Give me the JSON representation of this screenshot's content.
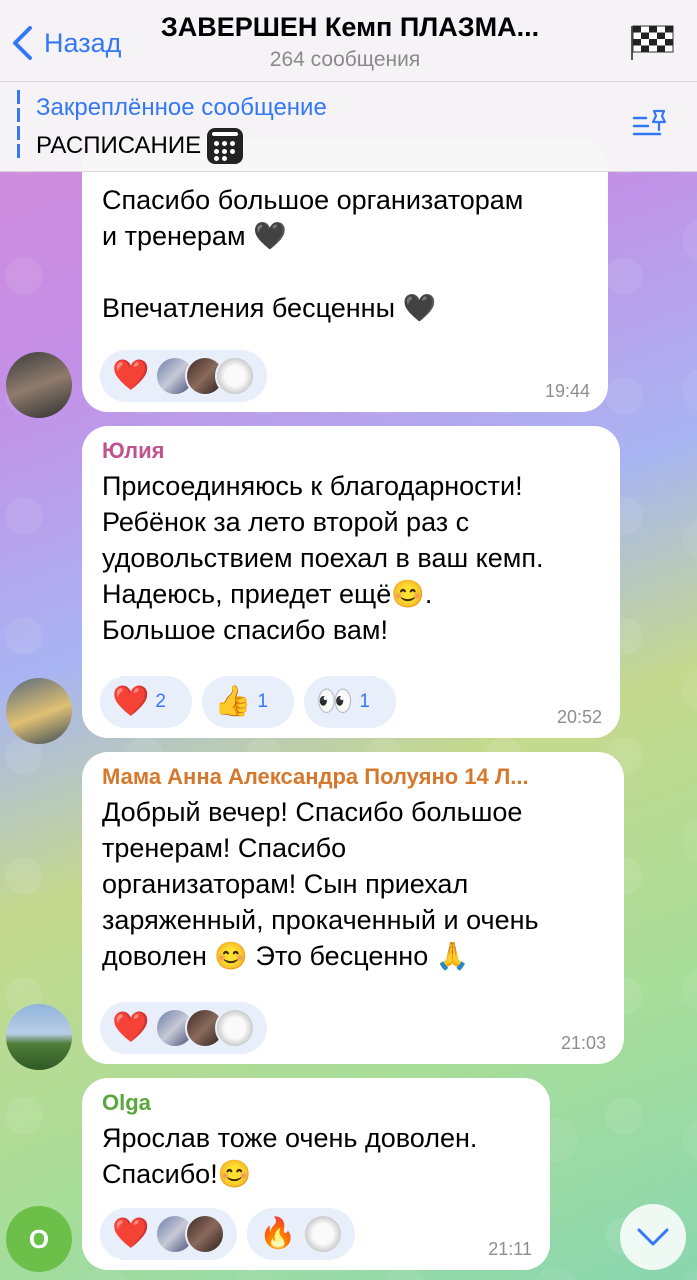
{
  "header": {
    "back_label": "Назад",
    "title": "ЗАВЕРШЕН Кемп ПЛАЗМА...",
    "subtitle": "264 сообщения"
  },
  "pinned": {
    "title": "Закреплённое сообщение",
    "text": "РАСПИСАНИЕ"
  },
  "messages": [
    {
      "text": "Спасибо большое организаторам\nи тренерам 🖤\n\nВпечатления бесценны 🖤",
      "time": "19:44",
      "reactions": [
        {
          "emoji": "❤️",
          "avatars": 3
        }
      ]
    },
    {
      "sender": "Юлия",
      "sender_color": "#c0538e",
      "text": "Присоединяюсь к благодарности!\nРебёнок за лето второй раз с\nудовольствием поехал в ваш кемп.\nНадеюсь, приедет ещё😊.\nБольшое спасибо вам!",
      "time": "20:52",
      "reactions": [
        {
          "emoji": "❤️",
          "count": "2"
        },
        {
          "emoji": "👍",
          "count": "1"
        },
        {
          "emoji": "👀",
          "count": "1"
        }
      ]
    },
    {
      "sender": "Мама Анна Александра Полуяно 14 Л...",
      "sender_color": "#d6782b",
      "text": "Добрый вечер! Спасибо большое\nтренерам! Спасибо\nорганизаторам! Сын приехал\nзаряженный, прокаченный и очень\nдоволен 😊 Это бесценно 🙏",
      "time": "21:03",
      "reactions": [
        {
          "emoji": "❤️",
          "avatars": 3
        }
      ]
    },
    {
      "sender": "Olga",
      "sender_color": "#5aa83c",
      "text": "Ярослав тоже очень доволен.\nСпасибо!😊",
      "time": "21:11",
      "reactions": [
        {
          "emoji": "❤️",
          "avatars": 2
        },
        {
          "emoji": "🔥",
          "avatars": 1
        }
      ]
    }
  ],
  "avatars": {
    "olga_initial": "O"
  }
}
